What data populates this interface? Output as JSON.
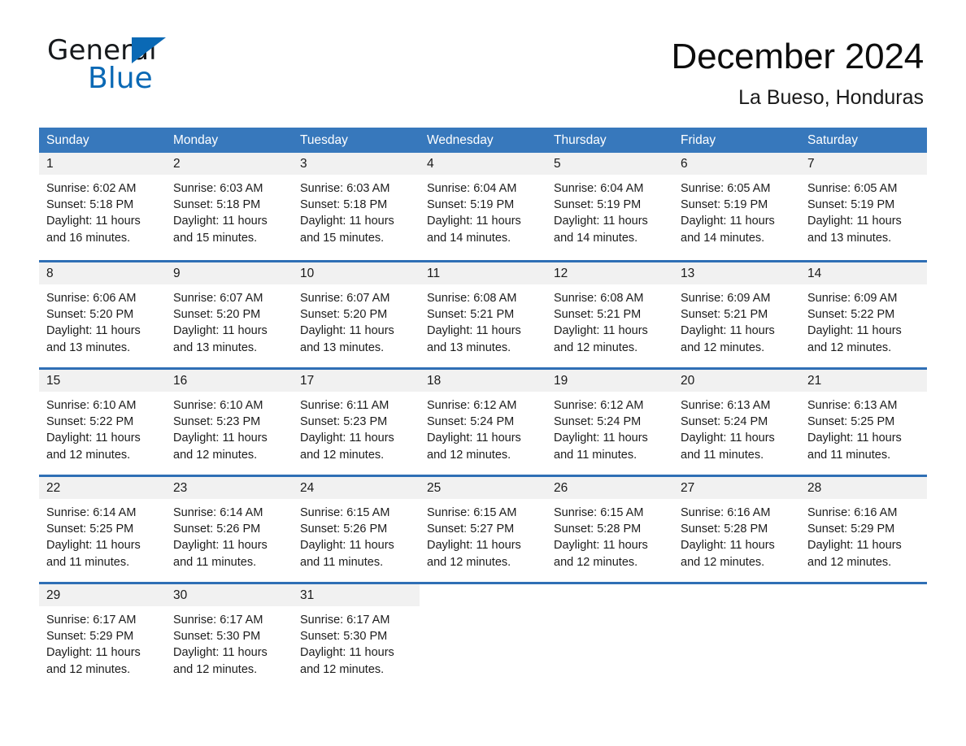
{
  "brand": {
    "word1": "General",
    "word2": "Blue",
    "accent_color": "#0a69b5",
    "triangle_icon": "triangle-icon"
  },
  "header": {
    "title": "December 2024",
    "subtitle": "La Bueso, Honduras"
  },
  "calendar": {
    "header_bg": "#3778bc",
    "row_divider_color": "#2f6fb5",
    "daynum_band_color": "#f1f1f1",
    "weekdays": [
      "Sunday",
      "Monday",
      "Tuesday",
      "Wednesday",
      "Thursday",
      "Friday",
      "Saturday"
    ],
    "weeks": [
      [
        {
          "day": "1",
          "sunrise": "Sunrise: 6:02 AM",
          "sunset": "Sunset: 5:18 PM",
          "daylight1": "Daylight: 11 hours",
          "daylight2": "and 16 minutes."
        },
        {
          "day": "2",
          "sunrise": "Sunrise: 6:03 AM",
          "sunset": "Sunset: 5:18 PM",
          "daylight1": "Daylight: 11 hours",
          "daylight2": "and 15 minutes."
        },
        {
          "day": "3",
          "sunrise": "Sunrise: 6:03 AM",
          "sunset": "Sunset: 5:18 PM",
          "daylight1": "Daylight: 11 hours",
          "daylight2": "and 15 minutes."
        },
        {
          "day": "4",
          "sunrise": "Sunrise: 6:04 AM",
          "sunset": "Sunset: 5:19 PM",
          "daylight1": "Daylight: 11 hours",
          "daylight2": "and 14 minutes."
        },
        {
          "day": "5",
          "sunrise": "Sunrise: 6:04 AM",
          "sunset": "Sunset: 5:19 PM",
          "daylight1": "Daylight: 11 hours",
          "daylight2": "and 14 minutes."
        },
        {
          "day": "6",
          "sunrise": "Sunrise: 6:05 AM",
          "sunset": "Sunset: 5:19 PM",
          "daylight1": "Daylight: 11 hours",
          "daylight2": "and 14 minutes."
        },
        {
          "day": "7",
          "sunrise": "Sunrise: 6:05 AM",
          "sunset": "Sunset: 5:19 PM",
          "daylight1": "Daylight: 11 hours",
          "daylight2": "and 13 minutes."
        }
      ],
      [
        {
          "day": "8",
          "sunrise": "Sunrise: 6:06 AM",
          "sunset": "Sunset: 5:20 PM",
          "daylight1": "Daylight: 11 hours",
          "daylight2": "and 13 minutes."
        },
        {
          "day": "9",
          "sunrise": "Sunrise: 6:07 AM",
          "sunset": "Sunset: 5:20 PM",
          "daylight1": "Daylight: 11 hours",
          "daylight2": "and 13 minutes."
        },
        {
          "day": "10",
          "sunrise": "Sunrise: 6:07 AM",
          "sunset": "Sunset: 5:20 PM",
          "daylight1": "Daylight: 11 hours",
          "daylight2": "and 13 minutes."
        },
        {
          "day": "11",
          "sunrise": "Sunrise: 6:08 AM",
          "sunset": "Sunset: 5:21 PM",
          "daylight1": "Daylight: 11 hours",
          "daylight2": "and 13 minutes."
        },
        {
          "day": "12",
          "sunrise": "Sunrise: 6:08 AM",
          "sunset": "Sunset: 5:21 PM",
          "daylight1": "Daylight: 11 hours",
          "daylight2": "and 12 minutes."
        },
        {
          "day": "13",
          "sunrise": "Sunrise: 6:09 AM",
          "sunset": "Sunset: 5:21 PM",
          "daylight1": "Daylight: 11 hours",
          "daylight2": "and 12 minutes."
        },
        {
          "day": "14",
          "sunrise": "Sunrise: 6:09 AM",
          "sunset": "Sunset: 5:22 PM",
          "daylight1": "Daylight: 11 hours",
          "daylight2": "and 12 minutes."
        }
      ],
      [
        {
          "day": "15",
          "sunrise": "Sunrise: 6:10 AM",
          "sunset": "Sunset: 5:22 PM",
          "daylight1": "Daylight: 11 hours",
          "daylight2": "and 12 minutes."
        },
        {
          "day": "16",
          "sunrise": "Sunrise: 6:10 AM",
          "sunset": "Sunset: 5:23 PM",
          "daylight1": "Daylight: 11 hours",
          "daylight2": "and 12 minutes."
        },
        {
          "day": "17",
          "sunrise": "Sunrise: 6:11 AM",
          "sunset": "Sunset: 5:23 PM",
          "daylight1": "Daylight: 11 hours",
          "daylight2": "and 12 minutes."
        },
        {
          "day": "18",
          "sunrise": "Sunrise: 6:12 AM",
          "sunset": "Sunset: 5:24 PM",
          "daylight1": "Daylight: 11 hours",
          "daylight2": "and 12 minutes."
        },
        {
          "day": "19",
          "sunrise": "Sunrise: 6:12 AM",
          "sunset": "Sunset: 5:24 PM",
          "daylight1": "Daylight: 11 hours",
          "daylight2": "and 11 minutes."
        },
        {
          "day": "20",
          "sunrise": "Sunrise: 6:13 AM",
          "sunset": "Sunset: 5:24 PM",
          "daylight1": "Daylight: 11 hours",
          "daylight2": "and 11 minutes."
        },
        {
          "day": "21",
          "sunrise": "Sunrise: 6:13 AM",
          "sunset": "Sunset: 5:25 PM",
          "daylight1": "Daylight: 11 hours",
          "daylight2": "and 11 minutes."
        }
      ],
      [
        {
          "day": "22",
          "sunrise": "Sunrise: 6:14 AM",
          "sunset": "Sunset: 5:25 PM",
          "daylight1": "Daylight: 11 hours",
          "daylight2": "and 11 minutes."
        },
        {
          "day": "23",
          "sunrise": "Sunrise: 6:14 AM",
          "sunset": "Sunset: 5:26 PM",
          "daylight1": "Daylight: 11 hours",
          "daylight2": "and 11 minutes."
        },
        {
          "day": "24",
          "sunrise": "Sunrise: 6:15 AM",
          "sunset": "Sunset: 5:26 PM",
          "daylight1": "Daylight: 11 hours",
          "daylight2": "and 11 minutes."
        },
        {
          "day": "25",
          "sunrise": "Sunrise: 6:15 AM",
          "sunset": "Sunset: 5:27 PM",
          "daylight1": "Daylight: 11 hours",
          "daylight2": "and 12 minutes."
        },
        {
          "day": "26",
          "sunrise": "Sunrise: 6:15 AM",
          "sunset": "Sunset: 5:28 PM",
          "daylight1": "Daylight: 11 hours",
          "daylight2": "and 12 minutes."
        },
        {
          "day": "27",
          "sunrise": "Sunrise: 6:16 AM",
          "sunset": "Sunset: 5:28 PM",
          "daylight1": "Daylight: 11 hours",
          "daylight2": "and 12 minutes."
        },
        {
          "day": "28",
          "sunrise": "Sunrise: 6:16 AM",
          "sunset": "Sunset: 5:29 PM",
          "daylight1": "Daylight: 11 hours",
          "daylight2": "and 12 minutes."
        }
      ],
      [
        {
          "day": "29",
          "sunrise": "Sunrise: 6:17 AM",
          "sunset": "Sunset: 5:29 PM",
          "daylight1": "Daylight: 11 hours",
          "daylight2": "and 12 minutes."
        },
        {
          "day": "30",
          "sunrise": "Sunrise: 6:17 AM",
          "sunset": "Sunset: 5:30 PM",
          "daylight1": "Daylight: 11 hours",
          "daylight2": "and 12 minutes."
        },
        {
          "day": "31",
          "sunrise": "Sunrise: 6:17 AM",
          "sunset": "Sunset: 5:30 PM",
          "daylight1": "Daylight: 11 hours",
          "daylight2": "and 12 minutes."
        },
        {
          "day": "",
          "sunrise": "",
          "sunset": "",
          "daylight1": "",
          "daylight2": ""
        },
        {
          "day": "",
          "sunrise": "",
          "sunset": "",
          "daylight1": "",
          "daylight2": ""
        },
        {
          "day": "",
          "sunrise": "",
          "sunset": "",
          "daylight1": "",
          "daylight2": ""
        },
        {
          "day": "",
          "sunrise": "",
          "sunset": "",
          "daylight1": "",
          "daylight2": ""
        }
      ]
    ]
  }
}
